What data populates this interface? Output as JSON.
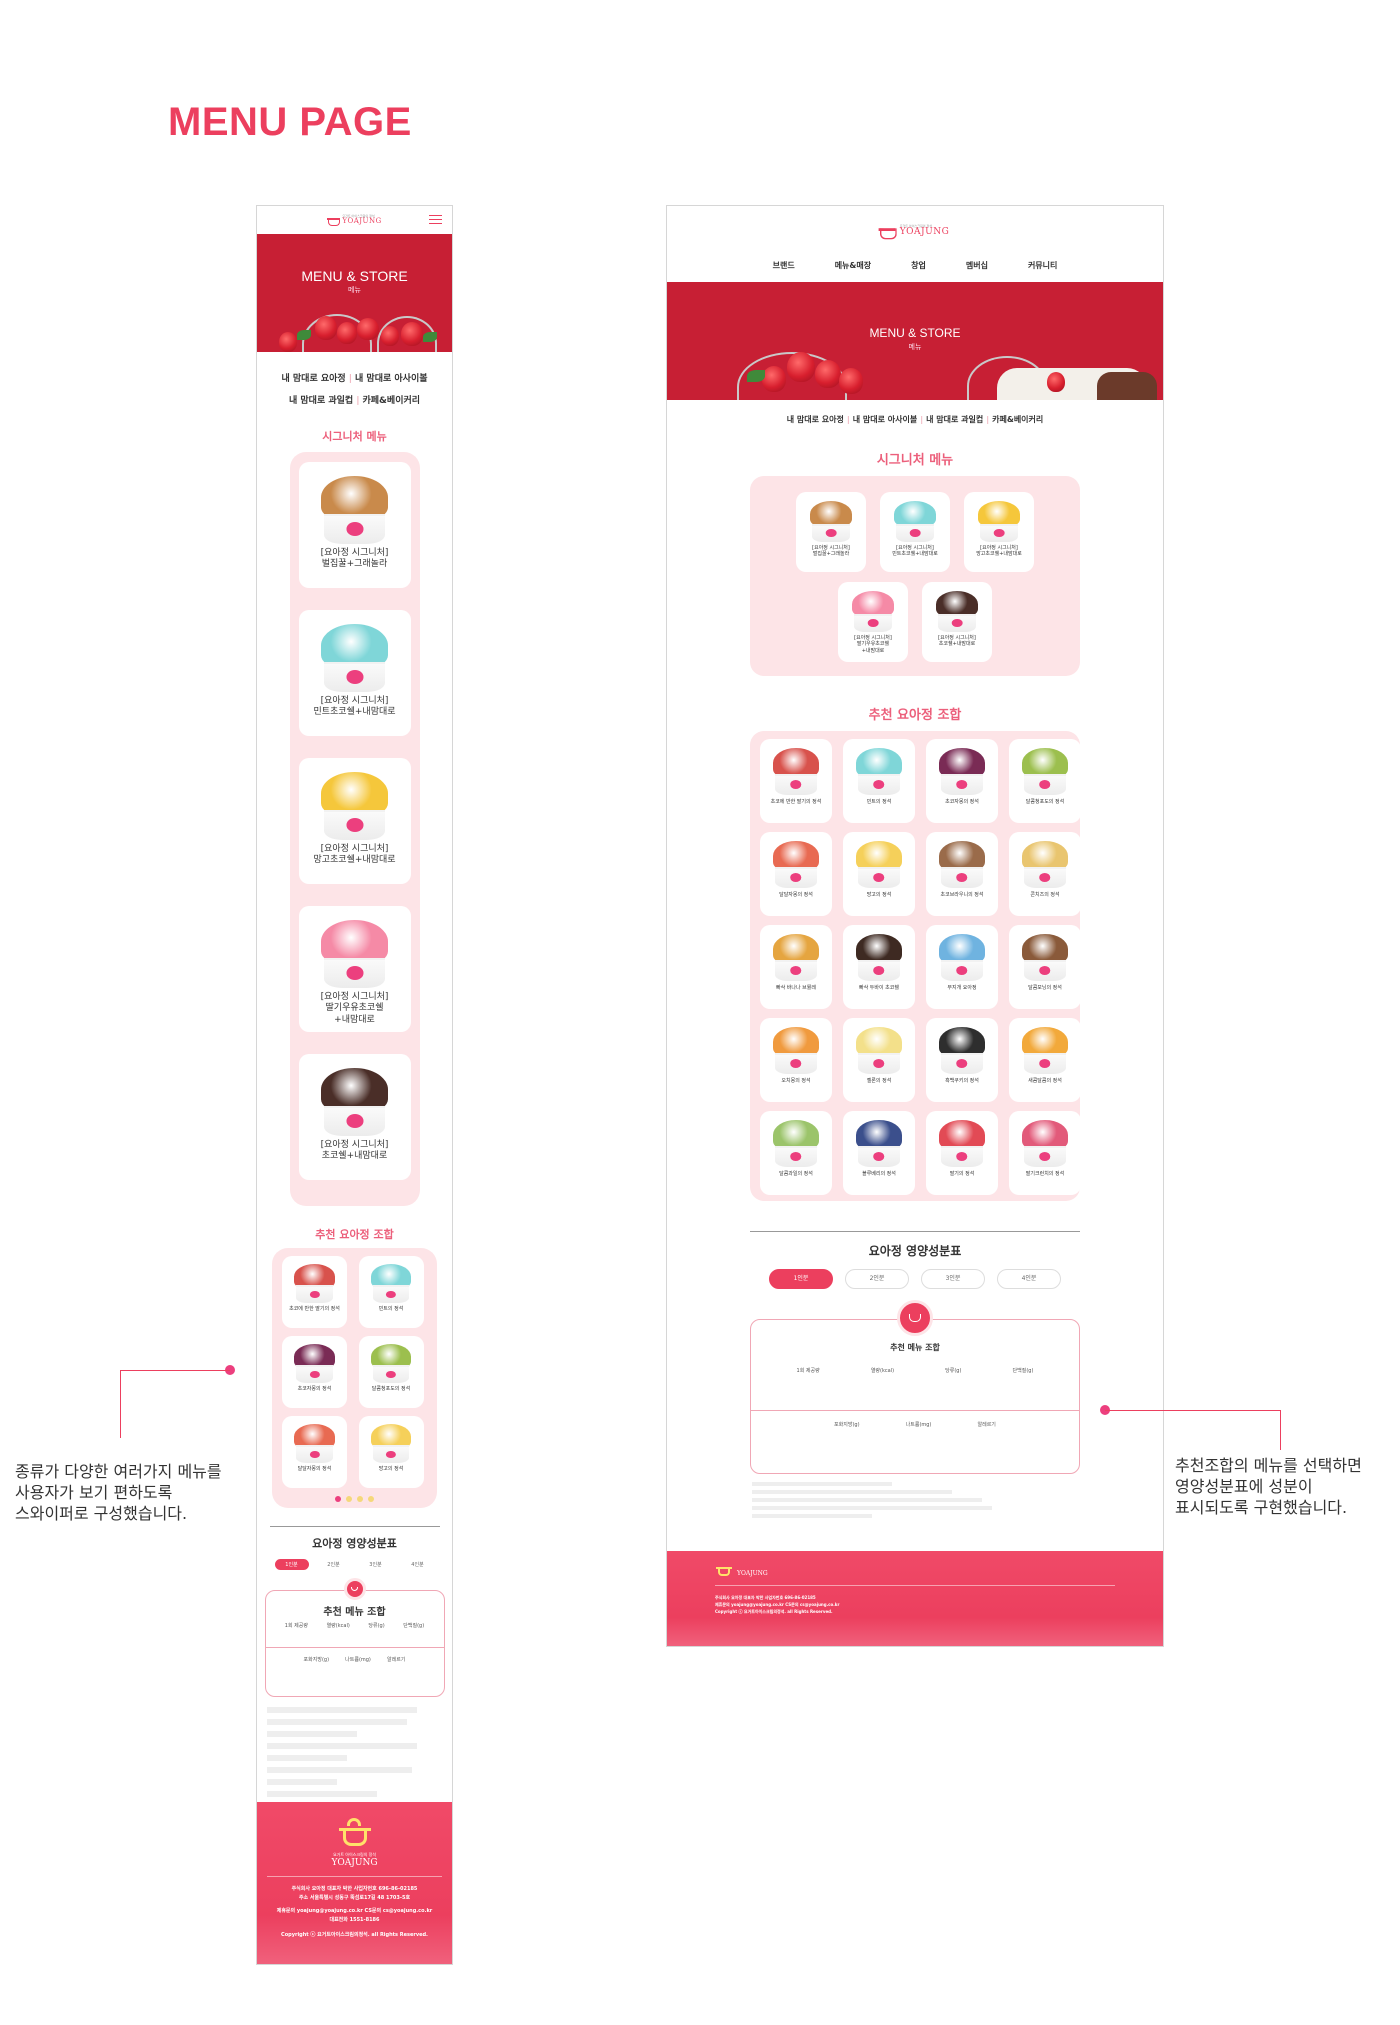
{
  "page_title": "MENU PAGE",
  "brand": {
    "sub": "요거트 아이스크림의 정석",
    "name": "YOAJUNG"
  },
  "colors": {
    "primary": "#ec3f5e",
    "panel": "#fde4e7",
    "hero": "#c71f34"
  },
  "hero": {
    "title": "MENU & STORE",
    "sub": "메뉴"
  },
  "nav": [
    "브랜드",
    "메뉴&매장",
    "창업",
    "멤버십",
    "커뮤니티"
  ],
  "categories": [
    "내 맘대로 요아정",
    "내 맘대로 아사이볼",
    "내 맘대로 과일컵",
    "카페&베이커리"
  ],
  "signature": {
    "title": "시그니처 메뉴",
    "items": [
      {
        "line1": "[요아정 시그니처]",
        "line2": "벌집꿀+그래놀라",
        "line3": "",
        "topping": "#c98a4b"
      },
      {
        "line1": "[요아정 시그니처]",
        "line2": "민트초코쉘+내맘대로",
        "line3": "",
        "topping": "#7fd6d8"
      },
      {
        "line1": "[요아정 시그니처]",
        "line2": "망고초코쉘+내맘대로",
        "line3": "",
        "topping": "#f5c73b"
      },
      {
        "line1": "[요아정 시그니처]",
        "line2": "딸기우유초코쉘",
        "line3": "+내맘대로",
        "topping": "#f58aa6"
      },
      {
        "line1": "[요아정 시그니처]",
        "line2": "초코쉘+내맘대로",
        "line3": "",
        "topping": "#4a2e28"
      }
    ]
  },
  "recommend": {
    "title": "추천 요아정 조합",
    "items": [
      {
        "label": "초코에 반한 딸기의 정석",
        "topping": "#d8524c"
      },
      {
        "label": "민트의 정석",
        "topping": "#7fd6d8"
      },
      {
        "label": "초코자몽의 정석",
        "topping": "#7a2b55"
      },
      {
        "label": "달콤청포도의 정석",
        "topping": "#9cbf4e"
      },
      {
        "label": "달달자몽의 정석",
        "topping": "#e86a52"
      },
      {
        "label": "망고의 정석",
        "topping": "#f5d05a"
      },
      {
        "label": "초코브라우니의 정석",
        "topping": "#9a6b4a"
      },
      {
        "label": "콘치즈의 정석",
        "topping": "#e9c56f"
      },
      {
        "label": "빠삭 바나나 브륄레",
        "topping": "#e5a540"
      },
      {
        "label": "빠삭 두바이 초코쉘",
        "topping": "#3e2a22"
      },
      {
        "label": "무지개 요아정",
        "topping": "#6fb3e0"
      },
      {
        "label": "달콤모닝의 정석",
        "topping": "#8a5a3a"
      },
      {
        "label": "오치몽의 정석",
        "topping": "#f09a3e"
      },
      {
        "label": "젤론의 정석",
        "topping": "#f3e08a"
      },
      {
        "label": "흑백쿠키의 정석",
        "topping": "#2e2e2e"
      },
      {
        "label": "새콤달콤의 정석",
        "topping": "#f2a93b"
      },
      {
        "label": "달콤과일의 정석",
        "topping": "#9bc46a"
      },
      {
        "label": "블루베리의 정석",
        "topping": "#3b4f8c"
      },
      {
        "label": "딸기의 정석",
        "topping": "#e24a55"
      },
      {
        "label": "딸기크런치의 정석",
        "topping": "#e25a7a"
      }
    ]
  },
  "nutrition": {
    "title": "요아정 영양성분표",
    "tabs": [
      "1인분",
      "2인분",
      "3인분",
      "4인분"
    ],
    "box_title": "추천 메뉴 조합",
    "row1": [
      "1회 제공량",
      "열량(kcal)",
      "당류(g)",
      "단백질(g)"
    ],
    "row2": [
      "포화지방(g)",
      "나트륨(mg)",
      "알레르기"
    ]
  },
  "footer": {
    "line1": "주식회사 요아정  대표자 박한 사업자번호 696-86-02185",
    "line2": "주소 서울특별시 성동구 뚝섬로17길 48 1703-5호",
    "line3": "제휴문의 yoajung@yoajung.co.kr  CS문의 cs@yoajung.co.kr",
    "line4": "대표전화 1551-8186",
    "copyright": "Copyright ⓒ 요거트아이스크림의정석. all Rights Reserved."
  },
  "annotations": {
    "left": [
      "종류가 다양한 여러가지 메뉴를",
      "사용자가 보기 편하도록",
      "스와이퍼로 구성했습니다."
    ],
    "right": [
      "추천조합의 메뉴를 선택하면",
      "영양성분표에 성분이",
      "표시되도록 구현했습니다."
    ]
  }
}
